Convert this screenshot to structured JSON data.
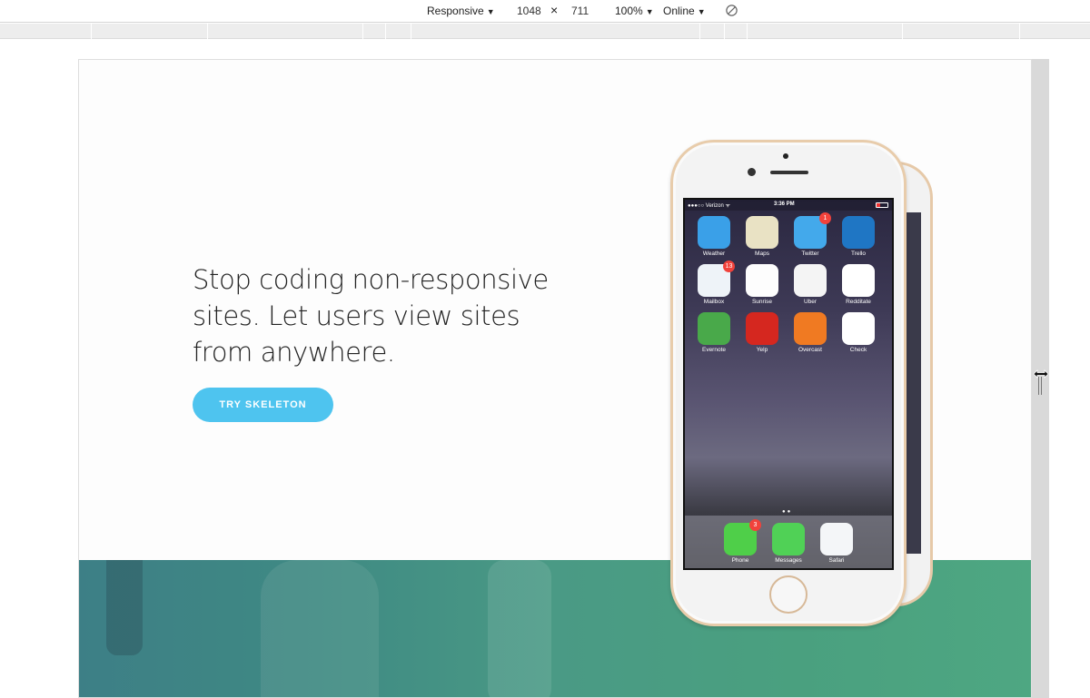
{
  "toolbar": {
    "device": "Responsive",
    "width": "1048",
    "times": "×",
    "height": "711",
    "zoom": "100%",
    "network": "Online",
    "arrow": "▼"
  },
  "hero": {
    "heading": "Stop coding non-responsive sites. Let users view sites from anywhere.",
    "cta_label": "TRY SKELETON"
  },
  "phone": {
    "carrier": "●●●○○ Verizon ᯤ",
    "time": "3:36 PM",
    "apps": [
      {
        "label": "Weather",
        "color": "#3aa0e8",
        "badge": ""
      },
      {
        "label": "Maps",
        "color": "#e9e2c4",
        "badge": ""
      },
      {
        "label": "Twitter",
        "color": "#43a9eb",
        "badge": "1"
      },
      {
        "label": "Trello",
        "color": "#1f76c4",
        "badge": ""
      },
      {
        "label": "Mailbox",
        "color": "#eef3f8",
        "badge": "13"
      },
      {
        "label": "Sunrise",
        "color": "#fdfdfd",
        "badge": ""
      },
      {
        "label": "Uber",
        "color": "#f4f4f4",
        "badge": ""
      },
      {
        "label": "Redditate",
        "color": "#ffffff",
        "badge": ""
      },
      {
        "label": "Evernote",
        "color": "#49a94a",
        "badge": ""
      },
      {
        "label": "Yelp",
        "color": "#d5271f",
        "badge": ""
      },
      {
        "label": "Overcast",
        "color": "#f07a22",
        "badge": ""
      },
      {
        "label": "Check",
        "color": "#ffffff",
        "badge": ""
      }
    ],
    "dock": [
      {
        "label": "Phone",
        "color": "#4fcf49",
        "badge": "3"
      },
      {
        "label": "Messages",
        "color": "#50d156",
        "badge": ""
      },
      {
        "label": "Safari",
        "color": "#f4f6f8",
        "badge": ""
      }
    ]
  }
}
